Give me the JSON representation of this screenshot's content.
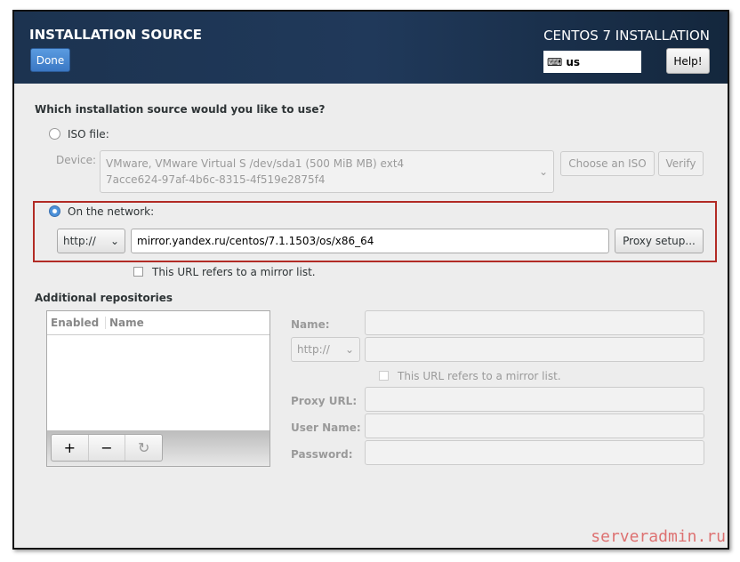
{
  "header": {
    "title": "INSTALLATION SOURCE",
    "done": "Done",
    "product": "CENTOS 7 INSTALLATION",
    "keyboard": "us",
    "help": "Help!"
  },
  "source": {
    "question": "Which installation source would you like to use?",
    "iso_label": "ISO file:",
    "device_label": "Device:",
    "device_line1": "VMware, VMware Virtual S /dev/sda1 (500 MiB MB) ext4",
    "device_line2": "7acce624-97af-4b6c-8315-4f519e2875f4",
    "choose_iso": "Choose an ISO",
    "verify": "Verify",
    "network_label": "On the network:",
    "protocol": "http://",
    "url": "mirror.yandex.ru/centos/7.1.1503/os/x86_64",
    "proxy_setup": "Proxy setup...",
    "mirror_list": "This URL refers to a mirror list."
  },
  "repos": {
    "title": "Additional repositories",
    "columns": [
      "Enabled",
      "Name"
    ],
    "add": "+",
    "remove": "−",
    "name_label": "Name:",
    "protocol": "http://",
    "mirror_list": "This URL refers to a mirror list.",
    "proxy_url_label": "Proxy URL:",
    "user_label": "User Name:",
    "password_label": "Password:"
  },
  "watermark": "serveradmin.ru"
}
